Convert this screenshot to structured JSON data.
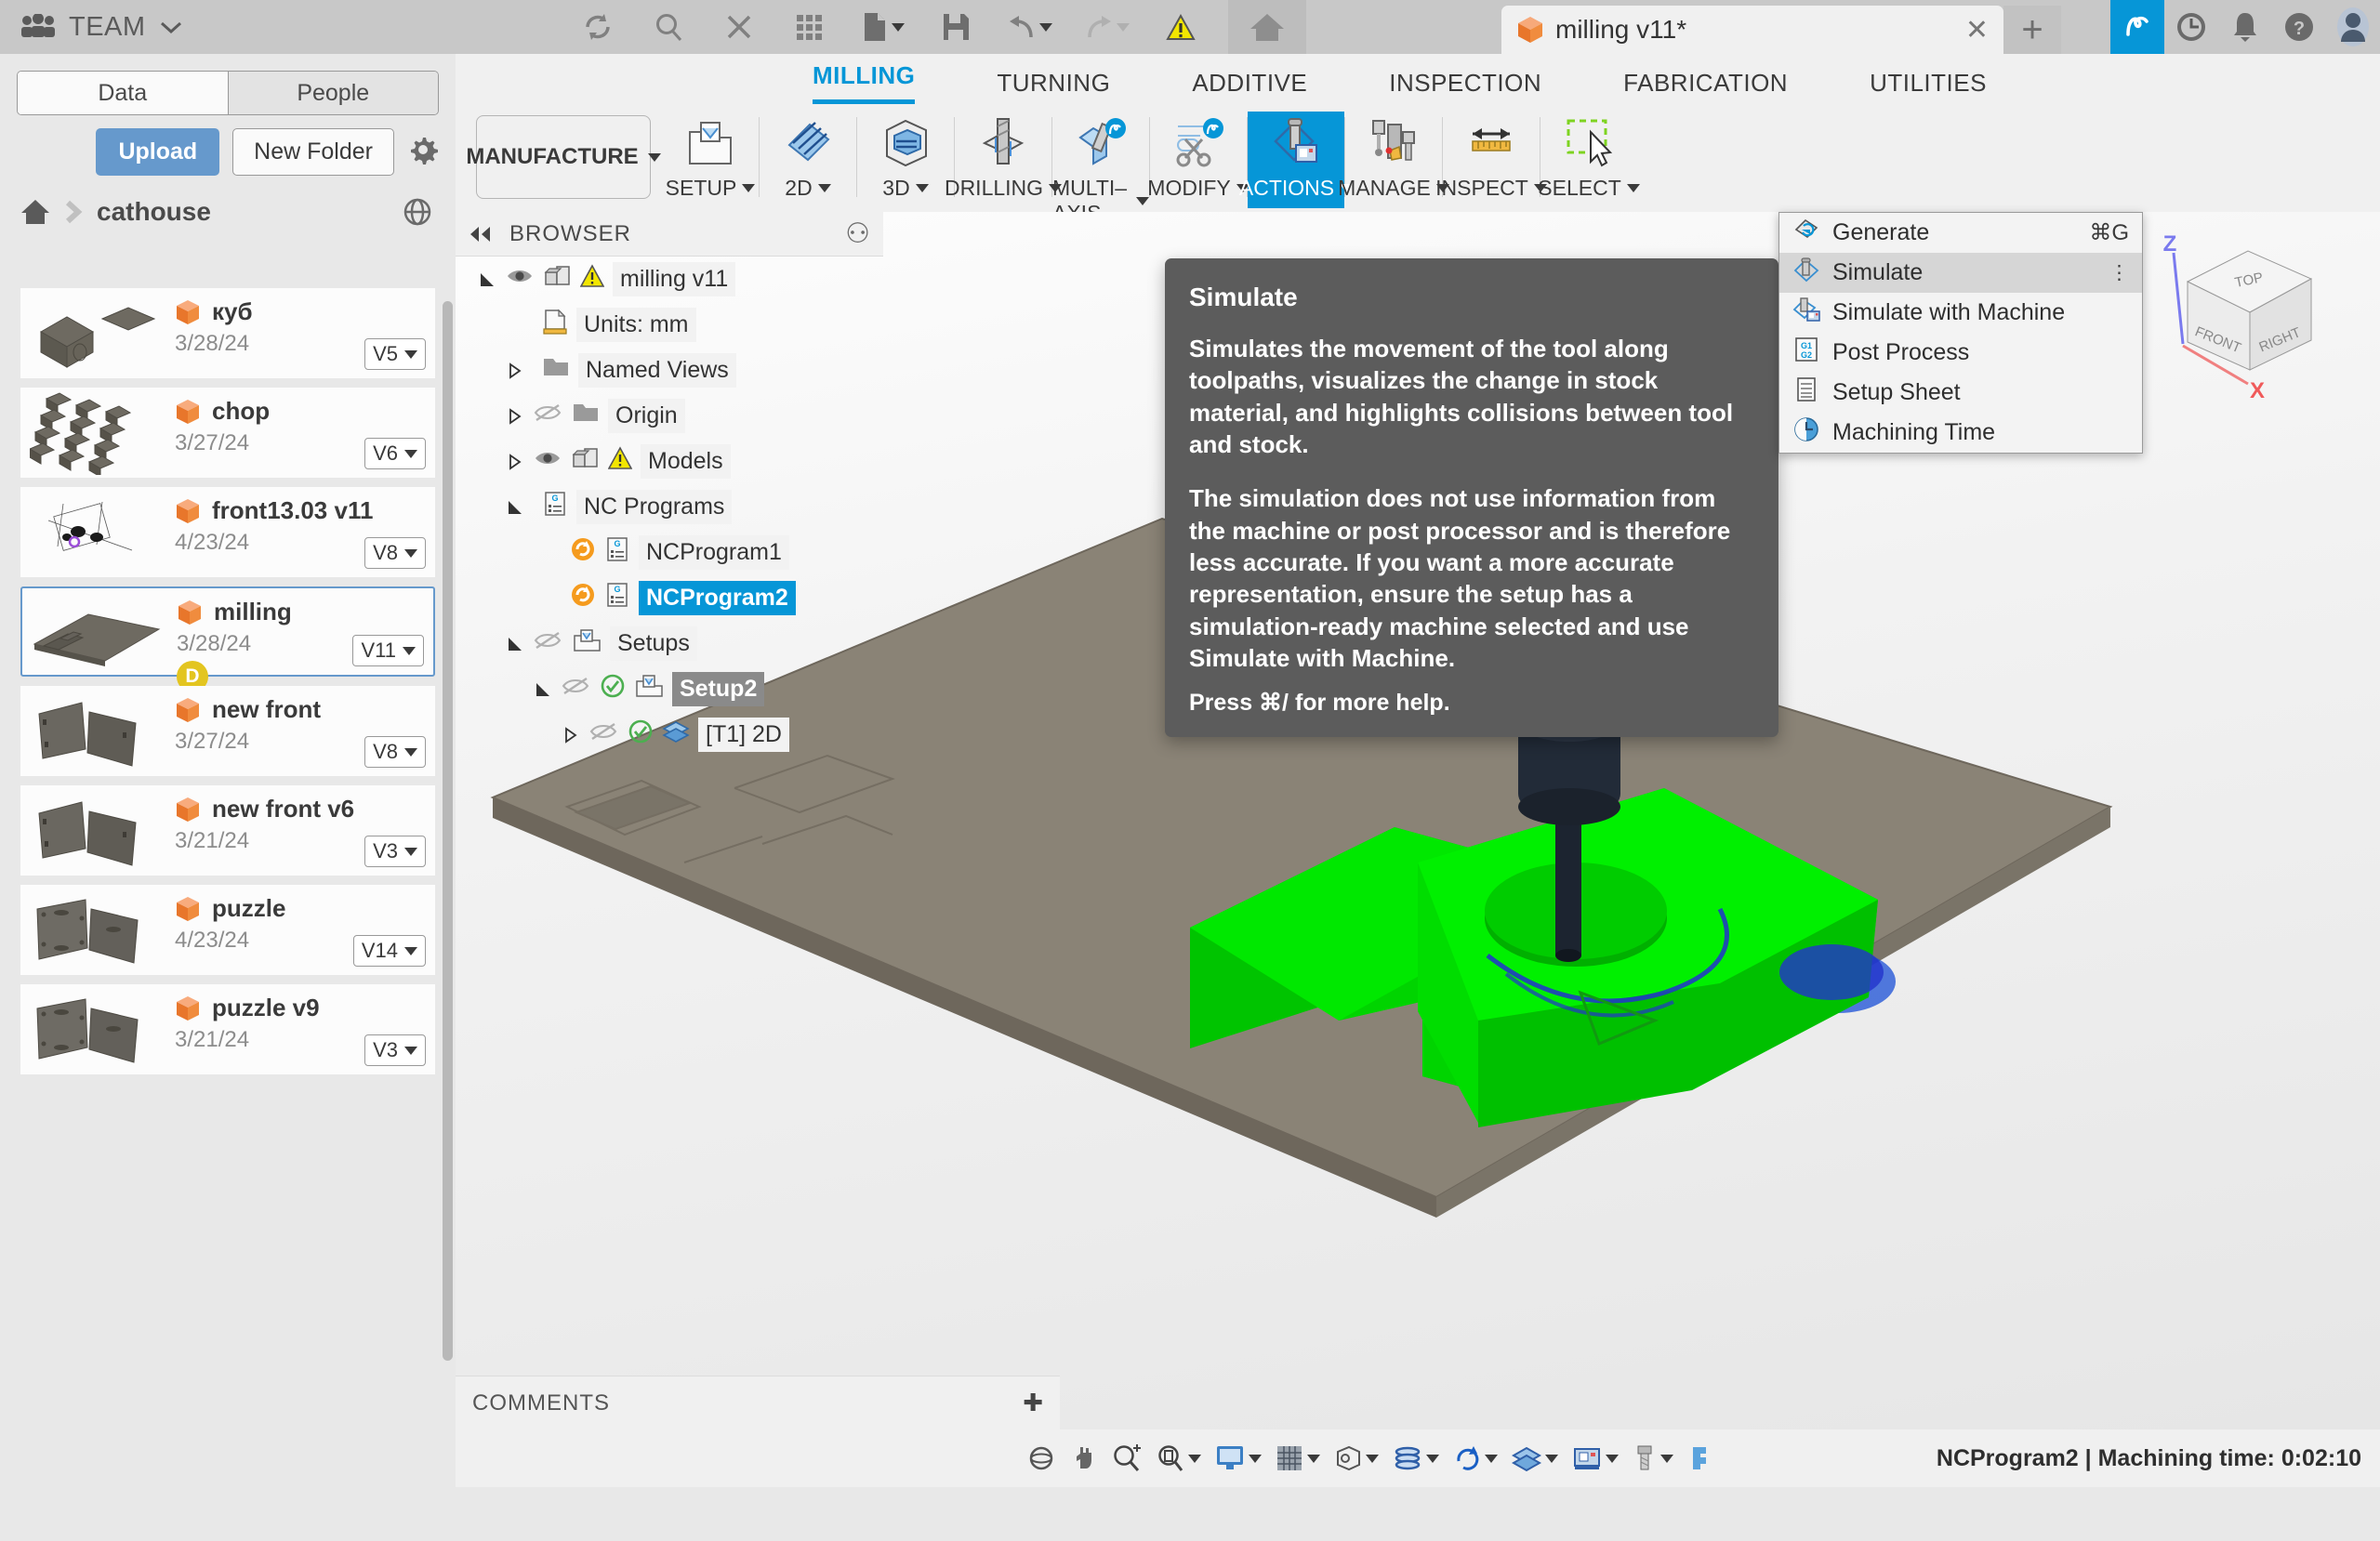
{
  "topbar": {
    "team_label": "TEAM",
    "icons": [
      "refresh-icon",
      "search-icon",
      "close-icon",
      "grid-icon",
      "new-file-icon",
      "save-icon",
      "undo-icon",
      "redo-icon",
      "warning-icon",
      "home-icon"
    ],
    "document_tab": {
      "title": "milling v11*",
      "close": "✕"
    },
    "new_tab": "+",
    "right_icons": [
      "fusion-logo-icon",
      "recent-icon",
      "notifications-icon",
      "help-icon",
      "account-avatar-icon"
    ]
  },
  "data_panel": {
    "tabs": [
      {
        "label": "Data",
        "active": true
      },
      {
        "label": "People",
        "active": false
      }
    ],
    "upload_label": "Upload",
    "new_folder_label": "New Folder",
    "breadcrumb": {
      "home": "home-icon",
      "folder": "cathouse"
    },
    "items": [
      {
        "name": "куб",
        "date": "3/28/24",
        "version": "V5",
        "selected": false,
        "thumb": "cube"
      },
      {
        "name": "chop",
        "date": "3/27/24",
        "version": "V6",
        "selected": false,
        "thumb": "grid"
      },
      {
        "name": "front13.03 v11",
        "date": "4/23/24",
        "version": "V8",
        "selected": false,
        "thumb": "drawing"
      },
      {
        "name": "milling",
        "date": "3/28/24",
        "version": "V11",
        "selected": true,
        "thumb": "plate",
        "badge": "D"
      },
      {
        "name": "new front",
        "date": "3/27/24",
        "version": "V8",
        "selected": false,
        "thumb": "panels"
      },
      {
        "name": "new front v6",
        "date": "3/21/24",
        "version": "V3",
        "selected": false,
        "thumb": "panels"
      },
      {
        "name": "puzzle",
        "date": "4/23/24",
        "version": "V14",
        "selected": false,
        "thumb": "panels2"
      },
      {
        "name": "puzzle v9",
        "date": "3/21/24",
        "version": "V3",
        "selected": false,
        "thumb": "panels2"
      }
    ]
  },
  "ribbon": {
    "workspace": "MANUFACTURE",
    "tabs": [
      {
        "label": "MILLING",
        "active": true
      },
      {
        "label": "TURNING",
        "active": false
      },
      {
        "label": "ADDITIVE",
        "active": false
      },
      {
        "label": "INSPECTION",
        "active": false
      },
      {
        "label": "FABRICATION",
        "active": false
      },
      {
        "label": "UTILITIES",
        "active": false
      }
    ],
    "groups": [
      {
        "label": "SETUP",
        "icon": "setup-icon",
        "highlight": false
      },
      {
        "label": "2D",
        "icon": "twod-icon",
        "highlight": false
      },
      {
        "label": "3D",
        "icon": "threed-icon",
        "highlight": false
      },
      {
        "label": "DRILLING",
        "icon": "drilling-icon",
        "highlight": false
      },
      {
        "label": "MULTI–AXIS",
        "icon": "multiaxis-icon",
        "highlight": false
      },
      {
        "label": "MODIFY",
        "icon": "modify-icon",
        "highlight": false
      },
      {
        "label": "ACTIONS",
        "icon": "actions-icon",
        "highlight": true
      },
      {
        "label": "MANAGE",
        "icon": "manage-icon",
        "highlight": false
      },
      {
        "label": "INSPECT",
        "icon": "inspect-icon",
        "highlight": false
      },
      {
        "label": "SELECT",
        "icon": "select-icon",
        "highlight": false
      }
    ]
  },
  "actions_menu": [
    {
      "label": "Generate",
      "icon": "generate-icon",
      "shortcut": "⌘G",
      "hover": false,
      "overflow": false
    },
    {
      "label": "Simulate",
      "icon": "simulate-icon",
      "shortcut": "",
      "hover": true,
      "overflow": true
    },
    {
      "label": "Simulate with Machine",
      "icon": "simulate-machine-icon",
      "shortcut": "",
      "hover": false,
      "overflow": false
    },
    {
      "label": "Post Process",
      "icon": "post-process-icon",
      "shortcut": "",
      "hover": false,
      "overflow": false
    },
    {
      "label": "Setup Sheet",
      "icon": "setup-sheet-icon",
      "shortcut": "",
      "hover": false,
      "overflow": false
    },
    {
      "label": "Machining Time",
      "icon": "machining-time-icon",
      "shortcut": "",
      "hover": false,
      "overflow": false
    }
  ],
  "tooltip": {
    "title": "Simulate",
    "paragraph1": "Simulates the movement of the tool along toolpaths, visualizes the change in stock material, and highlights collisions between tool and stock.",
    "paragraph2": "The simulation does not use information from the machine or post processor and is therefore less accurate. If you want a more accurate representation, ensure the setup has a simulation-ready machine selected and use Simulate with Machine.",
    "help": "Press ⌘/ for more help."
  },
  "browser": {
    "header": "BROWSER",
    "collapse_icon": "collapse-left-icon",
    "pin_icon": "pin-icon",
    "tree": [
      {
        "label": "milling v11",
        "indent": 0,
        "expander": "open",
        "eye": "visible",
        "icons": [
          "model-icon",
          "warning-icon"
        ],
        "state": "normal"
      },
      {
        "label": "Units: mm",
        "indent": 1,
        "expander": "none",
        "eye": "none",
        "icons": [
          "units-icon"
        ],
        "state": "normal"
      },
      {
        "label": "Named Views",
        "indent": 1,
        "expander": "closed",
        "eye": "none",
        "icons": [
          "folder-icon"
        ],
        "state": "normal"
      },
      {
        "label": "Origin",
        "indent": 1,
        "expander": "closed",
        "eye": "hidden",
        "icons": [
          "folder-icon"
        ],
        "state": "normal"
      },
      {
        "label": "Models",
        "indent": 1,
        "expander": "closed",
        "eye": "visible",
        "icons": [
          "model-icon",
          "warning-icon"
        ],
        "state": "normal"
      },
      {
        "label": "NC Programs",
        "indent": 1,
        "expander": "open",
        "eye": "none",
        "icons": [
          "nc-icon"
        ],
        "state": "normal"
      },
      {
        "label": "NCProgram1",
        "indent": 2,
        "expander": "none",
        "eye": "none",
        "icons": [
          "regen-icon",
          "nc-icon"
        ],
        "state": "normal"
      },
      {
        "label": "NCProgram2",
        "indent": 2,
        "expander": "none",
        "eye": "none",
        "icons": [
          "regen-icon",
          "nc-icon"
        ],
        "state": "selected-blue"
      },
      {
        "label": "Setups",
        "indent": 1,
        "expander": "open",
        "eye": "hidden",
        "icons": [
          "setup-folder-icon"
        ],
        "state": "normal"
      },
      {
        "label": "Setup2",
        "indent": 2,
        "expander": "open",
        "eye": "hidden",
        "icons": [
          "check-icon",
          "setup-folder-icon"
        ],
        "state": "selected-gray"
      },
      {
        "label": "[T1] 2D",
        "indent": 3,
        "expander": "closed",
        "eye": "hidden",
        "icons": [
          "check-icon",
          "toolpath-icon"
        ],
        "state": "normal"
      }
    ]
  },
  "viewcube": {
    "top": "TOP",
    "front": "FRONT",
    "right": "RIGHT",
    "axis_z": "Z",
    "axis_x": "X"
  },
  "comments": {
    "label": "COMMENTS",
    "add_icon": "add-comment-icon"
  },
  "bottombar": {
    "nav_icons": [
      "orbit-icon",
      "pan-icon",
      "zoom-icon",
      "zoom-window-icon",
      "display-settings-icon",
      "grid-snap-icon",
      "viewports-icon",
      "toolpath-display-icon",
      "simulation-icon",
      "toolpath-icon",
      "machine-icon",
      "tool-icon",
      "stock-icon"
    ],
    "status": "NCProgram2 | Machining time: 0:02:10"
  },
  "colors": {
    "accent": "#0696d7",
    "orange": "#ef8a2b",
    "green_toolpath": "#00e000",
    "warning": "#f2e600",
    "tooltip_bg": "#5c5c5c"
  }
}
